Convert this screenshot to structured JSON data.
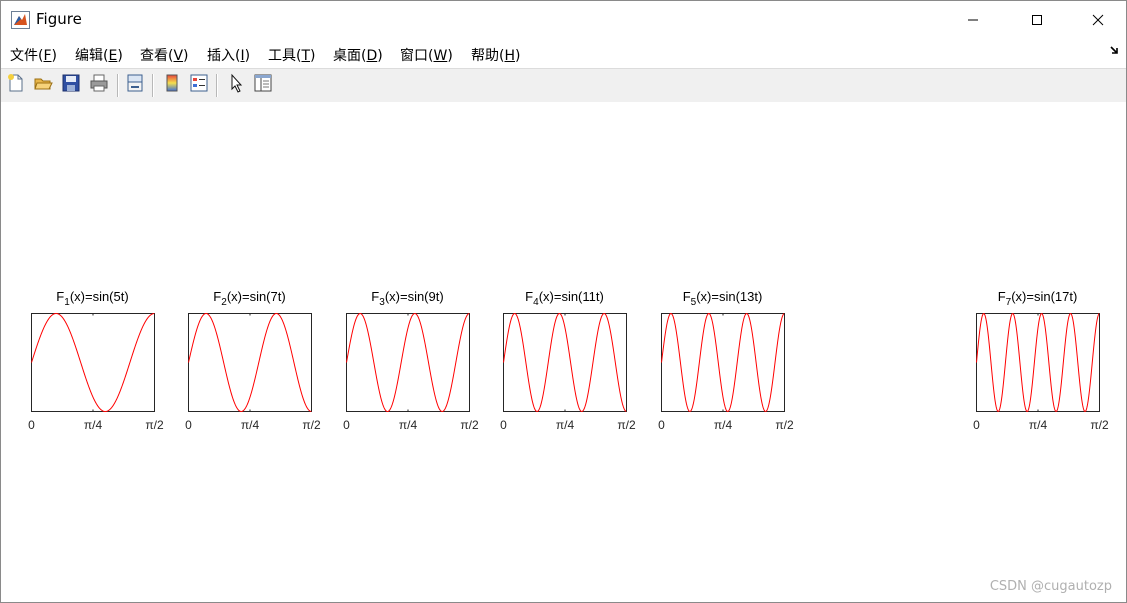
{
  "window": {
    "title": "Figure",
    "controls": {
      "minimize": "minimize",
      "maximize": "maximize",
      "close": "close"
    }
  },
  "menu": [
    {
      "text": "文件(",
      "key": "F",
      "tail": ")"
    },
    {
      "text": "编辑(",
      "key": "E",
      "tail": ")"
    },
    {
      "text": "查看(",
      "key": "V",
      "tail": ")"
    },
    {
      "text": "插入(",
      "key": "I",
      "tail": ")"
    },
    {
      "text": "工具(",
      "key": "T",
      "tail": ")"
    },
    {
      "text": "桌面(",
      "key": "D",
      "tail": ")"
    },
    {
      "text": "窗口(",
      "key": "W",
      "tail": ")"
    },
    {
      "text": "帮助(",
      "key": "H",
      "tail": ")"
    }
  ],
  "toolbar": {
    "icons": [
      "new-figure-icon",
      "open-file-icon",
      "save-icon",
      "print-icon",
      "link-plot-icon",
      "colorbar-icon",
      "legend-icon",
      "edit-plot-icon",
      "property-inspector-icon"
    ]
  },
  "watermark": "CSDN @cugautozp",
  "chart_data": [
    {
      "type": "line",
      "title": {
        "base": "F",
        "sub": "1",
        "rest": "(x)=sin(5t)"
      },
      "function": "sin(5t)",
      "frequency": 5,
      "xlim": [
        0,
        1.5708
      ],
      "ylim": [
        -1,
        1
      ],
      "xticks": [
        "0",
        "π/4",
        "π/2"
      ],
      "color": "#ff0000",
      "grid": false
    },
    {
      "type": "line",
      "title": {
        "base": "F",
        "sub": "2",
        "rest": "(x)=sin(7t)"
      },
      "function": "sin(7t)",
      "frequency": 7,
      "xlim": [
        0,
        1.5708
      ],
      "ylim": [
        -1,
        1
      ],
      "xticks": [
        "0",
        "π/4",
        "π/2"
      ],
      "color": "#ff0000",
      "grid": false
    },
    {
      "type": "line",
      "title": {
        "base": "F",
        "sub": "3",
        "rest": "(x)=sin(9t)"
      },
      "function": "sin(9t)",
      "frequency": 9,
      "xlim": [
        0,
        1.5708
      ],
      "ylim": [
        -1,
        1
      ],
      "xticks": [
        "0",
        "π/4",
        "π/2"
      ],
      "color": "#ff0000",
      "grid": false
    },
    {
      "type": "line",
      "title": {
        "base": "F",
        "sub": "4",
        "rest": "(x)=sin(11t)"
      },
      "function": "sin(11t)",
      "frequency": 11,
      "xlim": [
        0,
        1.5708
      ],
      "ylim": [
        -1,
        1
      ],
      "xticks": [
        "0",
        "π/4",
        "π/2"
      ],
      "color": "#ff0000",
      "grid": false
    },
    {
      "type": "line",
      "title": {
        "base": "F",
        "sub": "5",
        "rest": "(x)=sin(13t)"
      },
      "function": "sin(13t)",
      "frequency": 13,
      "xlim": [
        0,
        1.5708
      ],
      "ylim": [
        -1,
        1
      ],
      "xticks": [
        "0",
        "π/4",
        "π/2"
      ],
      "color": "#ff0000",
      "grid": false
    },
    {
      "type": "line",
      "title": {
        "base": "F",
        "sub": "7",
        "rest": "(x)=sin(17t)"
      },
      "function": "sin(17t)",
      "frequency": 17,
      "xlim": [
        0,
        1.5708
      ],
      "ylim": [
        -1,
        1
      ],
      "xticks": [
        "0",
        "π/4",
        "π/2"
      ],
      "color": "#ff0000",
      "grid": false
    }
  ]
}
